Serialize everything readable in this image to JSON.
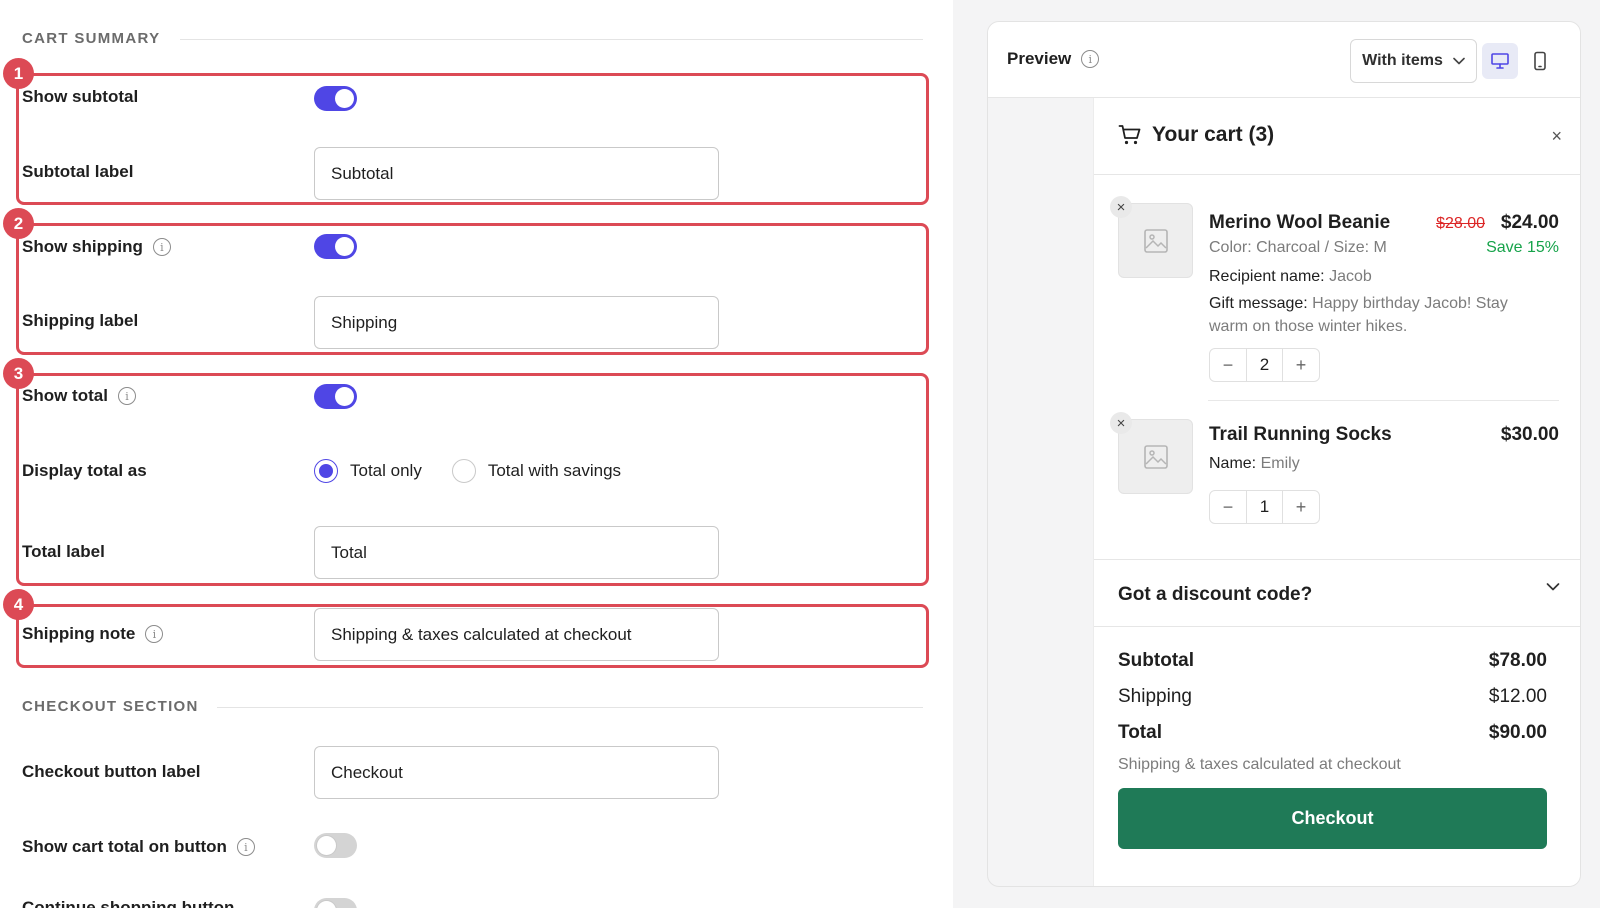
{
  "settings": {
    "cart_summary_title": "CART SUMMARY",
    "checkout_section_title": "CHECKOUT SECTION",
    "show_subtotal": {
      "label": "Show subtotal",
      "enabled": true
    },
    "subtotal_label": {
      "label": "Subtotal label",
      "value": "Subtotal"
    },
    "show_shipping": {
      "label": "Show shipping",
      "enabled": true
    },
    "shipping_label": {
      "label": "Shipping label",
      "value": "Shipping"
    },
    "show_total": {
      "label": "Show total",
      "enabled": true
    },
    "display_total_as": {
      "label": "Display total as",
      "options": [
        "Total only",
        "Total with savings"
      ],
      "selected": "Total only"
    },
    "total_label": {
      "label": "Total label",
      "value": "Total"
    },
    "shipping_note": {
      "label": "Shipping note",
      "value": "Shipping & taxes calculated at checkout"
    },
    "checkout_button_label": {
      "label": "Checkout button label",
      "value": "Checkout"
    },
    "show_cart_total_on_button": {
      "label": "Show cart total on button",
      "enabled": false
    },
    "continue_shopping_button": {
      "label": "Continue shopping button",
      "enabled": false
    }
  },
  "annotations": [
    "1",
    "2",
    "3",
    "4"
  ],
  "annotation_color": "#dc4a55",
  "accent_color": "#4f46e5",
  "preview": {
    "title": "Preview",
    "mode_select": "With items",
    "devices": [
      "desktop-icon",
      "mobile-icon"
    ],
    "cart": {
      "title": "Your cart (3)",
      "close": "×",
      "items": [
        {
          "name": "Merino Wool Beanie",
          "price_original": "$28.00",
          "price": "$24.00",
          "savings": "Save 15%",
          "variant": "Color: Charcoal / Size: M",
          "prop1_key": "Recipient name:",
          "prop1_val": "Jacob",
          "prop2_key": "Gift message:",
          "prop2_val": "Happy birthday Jacob! Stay warm on those winter hikes.",
          "quantity": "2"
        },
        {
          "name": "Trail Running Socks",
          "price": "$30.00",
          "prop1_key": "Name:",
          "prop1_val": "Emily",
          "quantity": "1"
        }
      ],
      "qty_minus": "−",
      "qty_plus": "+",
      "remove": "×",
      "discount_label": "Got a discount code?",
      "summary": {
        "subtotal_label": "Subtotal",
        "subtotal_value": "$78.00",
        "shipping_label": "Shipping",
        "shipping_value": "$12.00",
        "total_label": "Total",
        "total_value": "$90.00"
      },
      "note": "Shipping & taxes calculated at checkout",
      "checkout_button": "Checkout",
      "checkout_color": "#1f7a57"
    }
  }
}
